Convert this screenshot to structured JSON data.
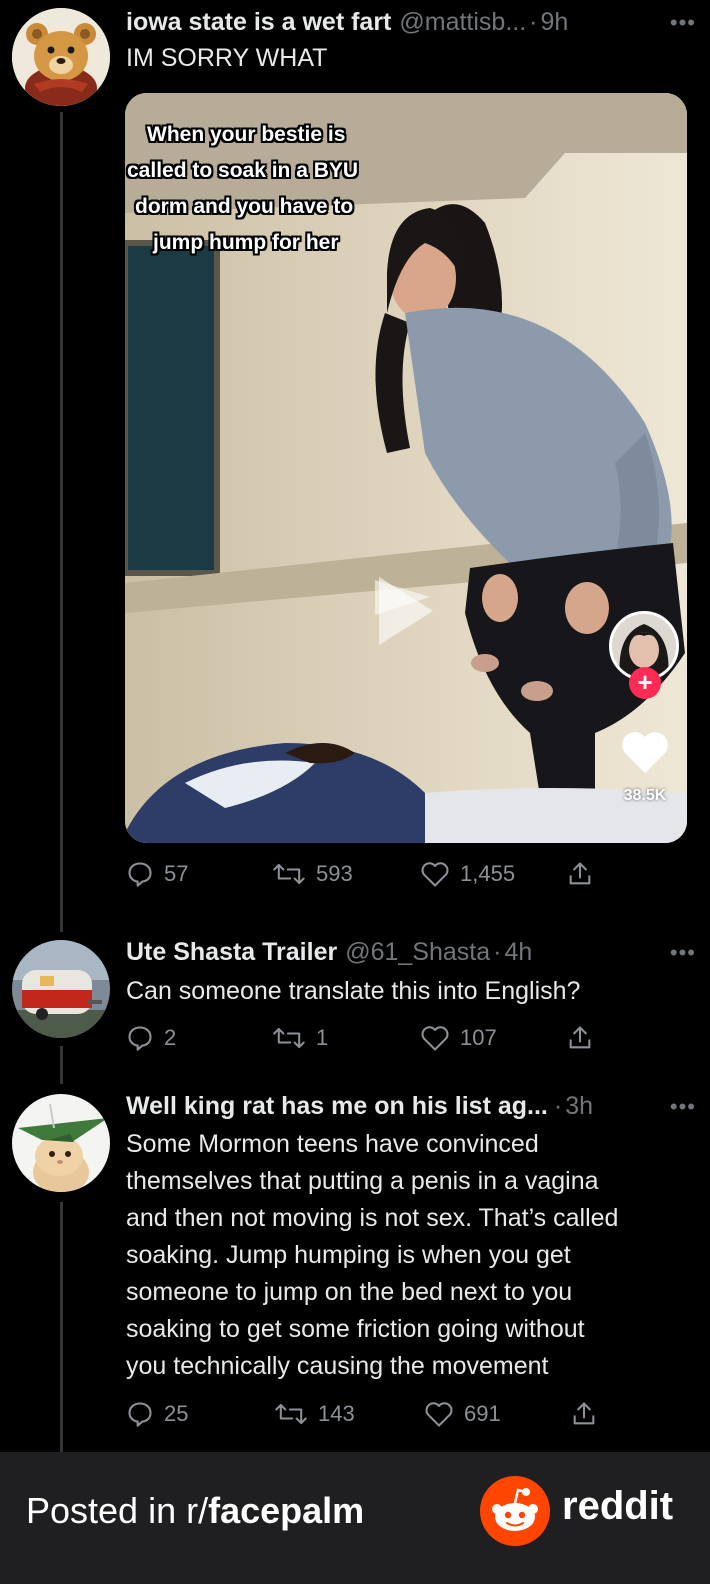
{
  "tweets": [
    {
      "name": "iowa state is a wet fart",
      "handle": "@mattisb...",
      "time": "9h",
      "text": "IM SORRY WHAT",
      "replies": "57",
      "retweets": "593",
      "likes": "1,455"
    },
    {
      "name": "Ute Shasta Trailer",
      "handle": "@61_Shasta",
      "time": "4h",
      "text": "Can someone translate this into English?",
      "replies": "2",
      "retweets": "1",
      "likes": "107"
    },
    {
      "name": "Well king rat has me on his list ag...",
      "handle": "",
      "time": "3h",
      "text_lines": [
        "Some Mormon teens have convinced",
        "themselves that putting a penis in a vagina",
        "and then not moving is not sex. That’s called",
        "soaking. Jump humping is when you get",
        "someone to jump on the bed next to you",
        "soaking to get some friction going without",
        "you technically causing the movement"
      ],
      "replies": "25",
      "retweets": "143",
      "likes": "691"
    }
  ],
  "media": {
    "caption_lines": [
      "When your bestie is",
      "called to soak in a BYU",
      "dorm and you have to",
      "jump hump for her"
    ],
    "like_count": "38.5K"
  },
  "footer": {
    "posted_prefix": "Posted in r/",
    "subreddit": "facepalm",
    "brand": "reddit"
  },
  "colors": {
    "background": "#000000",
    "text": "#e7e9ea",
    "muted": "#71767b",
    "footer_bg": "#1f1f22",
    "reddit_orange": "#ff4500",
    "follow_red": "#fe2c55"
  }
}
